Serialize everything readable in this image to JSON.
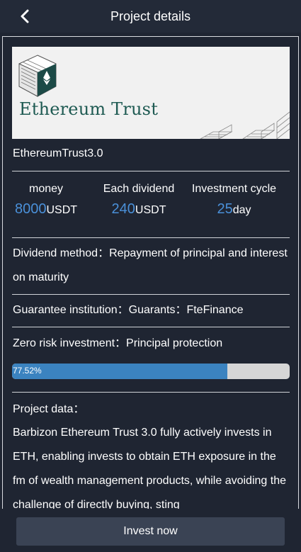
{
  "header": {
    "title": "Project details",
    "back_icon": "chevron-left-icon"
  },
  "banner": {
    "logo_text": "Ethereum Trust",
    "logo_icon": "ethereum-cube-icon"
  },
  "project": {
    "name": "EthereumTrust3.0"
  },
  "stats": [
    {
      "label": "money",
      "value": "8000",
      "unit": "USDT"
    },
    {
      "label": "Each dividend",
      "value": "240",
      "unit": "USDT"
    },
    {
      "label": "Investment cycle",
      "value": "25",
      "unit": "day"
    }
  ],
  "details": {
    "dividend_method": "Dividend method：Repayment of principal and interest on maturity",
    "guarantee": "Guarantee institution：Guarants：FteFinance",
    "zero_risk": "Zero risk investment：Principal protection"
  },
  "progress": {
    "label": "77.52%",
    "value": 0.7752
  },
  "project_data": {
    "title": "Project data：",
    "body": "Barbizon Ethereum Trust 3.0 fully actively invests in ETH, enabling invests to obtain ETH exposure in the fm of wealth management products, while avoiding the challenge of directly buying, sting"
  },
  "footer": {
    "invest_label": "Invest now"
  },
  "colors": {
    "background": "#1f2532",
    "accent": "#4a90d9",
    "progress": "#3b83c0",
    "button": "#3a4354"
  }
}
